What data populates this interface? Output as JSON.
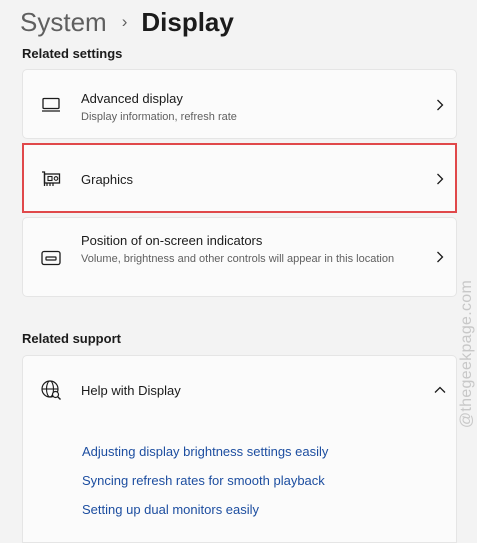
{
  "breadcrumb": {
    "parent": "System",
    "separator": "›",
    "current": "Display"
  },
  "related_settings": {
    "label": "Related settings",
    "items": [
      {
        "title": "Advanced display",
        "description": "Display information, refresh rate",
        "icon": "monitor-icon"
      },
      {
        "title": "Graphics",
        "description": "",
        "icon": "graphics-card-icon"
      },
      {
        "title": "Position of on-screen indicators",
        "description": "Volume, brightness and other controls will appear in this location",
        "icon": "osd-indicator-icon"
      }
    ]
  },
  "related_support": {
    "label": "Related support",
    "help": {
      "title": "Help with Display",
      "icon": "globe-search-icon",
      "expanded": true
    },
    "links": [
      "Adjusting display brightness settings easily",
      "Syncing refresh rates for smooth playback",
      "Setting up dual monitors easily"
    ]
  },
  "watermark": "@thegeekpage.com",
  "colors": {
    "highlight": "#e0484a",
    "link": "#1d4ea0",
    "background": "#f3f3f3",
    "card": "#fbfbfb"
  }
}
